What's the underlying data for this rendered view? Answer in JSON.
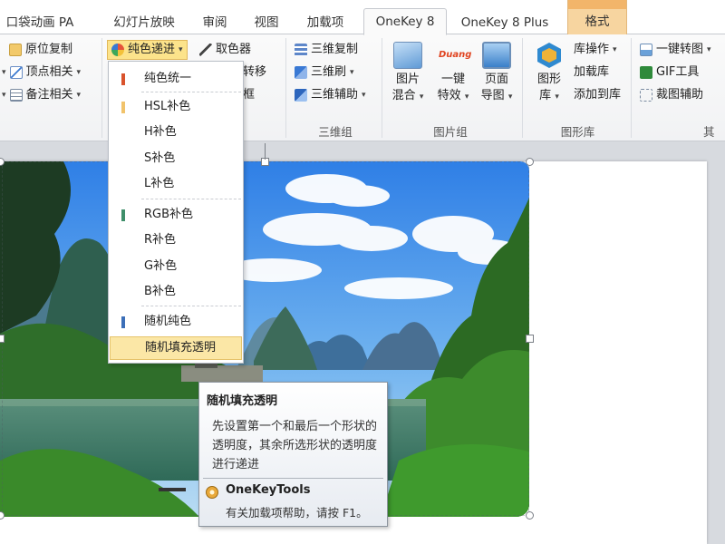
{
  "tabs": {
    "pocket": "口袋动画 PA",
    "slideshow": "幻灯片放映",
    "review": "审阅",
    "view": "视图",
    "addins": "加载项",
    "onekey8": "OneKey 8",
    "onekey8plus": "OneKey 8 Plus",
    "format": "格式"
  },
  "ribbon": {
    "group1": {
      "copy_in_place": "原位复制",
      "vertex": "顶点相关",
      "notes": "备注相关"
    },
    "group2": {
      "color_cascade": "纯色递进",
      "color_picker": "取色器",
      "transfer": "转移",
      "frame": "框"
    },
    "group3d": {
      "copy3d": "三维复制",
      "brush3d": "三维刷",
      "assist3d": "三维辅助",
      "label": "三维组"
    },
    "picture_group": {
      "mix_line1": "图片",
      "mix_line2": "混合",
      "effects_logo": "Duang",
      "effects_line1": "一键",
      "effects_line2": "特效",
      "page_line1": "页面",
      "page_line2": "导图",
      "label": "图片组"
    },
    "shape_lib": {
      "shape_line1": "图形",
      "shape_line2": "库",
      "lib_ops": "库操作",
      "load_lib": "加载库",
      "add_to_lib": "添加到库",
      "label": "图形库"
    },
    "other": {
      "to_image": "一键转图",
      "gif_tool": "GIF工具",
      "crop_assist": "裁图辅助",
      "label": "其"
    }
  },
  "menu": {
    "items": [
      {
        "label": "纯色统一",
        "swatch": "#d9532c"
      },
      {
        "label": "HSL补色",
        "swatch": "#f1c36b"
      },
      {
        "label": "H补色",
        "swatch": ""
      },
      {
        "label": "S补色",
        "swatch": ""
      },
      {
        "label": "L补色",
        "swatch": ""
      },
      {
        "label": "RGB补色",
        "swatch": "#3f8f6a"
      },
      {
        "label": "R补色",
        "swatch": ""
      },
      {
        "label": "G补色",
        "swatch": ""
      },
      {
        "label": "B补色",
        "swatch": ""
      },
      {
        "label": "随机纯色",
        "swatch": "#3c6fb8"
      },
      {
        "label": "随机填充透明",
        "swatch": ""
      }
    ]
  },
  "tooltip": {
    "title": "随机填充透明",
    "body": "先设置第一个和最后一个形状的透明度，其余所选形状的透明度进行递进",
    "brand": "OneKeyTools",
    "help": "有关加载项帮助，请按 F1。"
  }
}
